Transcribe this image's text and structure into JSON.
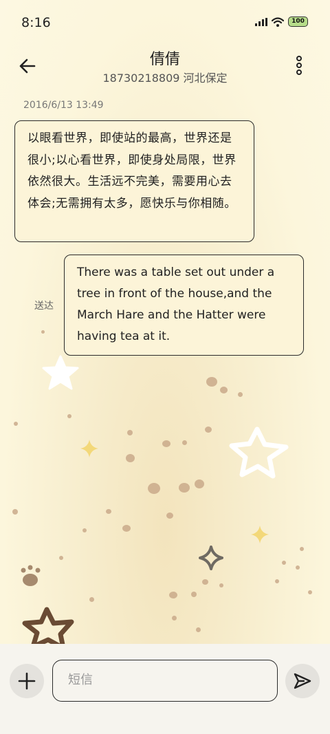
{
  "status_bar": {
    "time": "8:16",
    "battery": "100"
  },
  "header": {
    "title": "倩倩",
    "subtitle": "18730218809 河北保定"
  },
  "messages": [
    {
      "timestamp": "2016/6/13 13:49",
      "text": "以眼看世界，即使站的最高，世界还是很小;以心看世界，即使身处局限，世界依然很大。生活远不完美，需要用心去体会;无需拥有太多，愿快乐与你相随。"
    },
    {
      "text": "There was a table set out under a tree in front of the house,and the March Hare and the Hatter were having tea at it.",
      "status": "送达"
    }
  ],
  "compose": {
    "placeholder": "短信"
  },
  "icons": {
    "back": "arrow-left-icon",
    "more": "more-vertical-icon",
    "add": "plus-icon",
    "send": "send-icon"
  },
  "colors": {
    "background": "#fcf6dc",
    "bubble_border": "#2a2a2a",
    "compose_bar": "#f6f4ee"
  }
}
